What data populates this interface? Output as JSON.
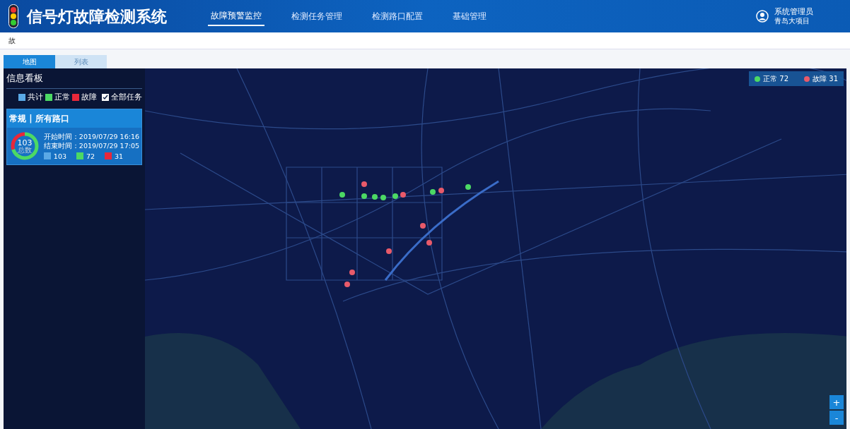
{
  "header": {
    "title": "信号灯故障检测系统",
    "nav": [
      {
        "label": "故障预警监控",
        "selected": true
      },
      {
        "label": "检测任务管理",
        "selected": false
      },
      {
        "label": "检测路口配置",
        "selected": false
      },
      {
        "label": "基础管理",
        "selected": false
      }
    ],
    "user": {
      "name": "系统管理员",
      "org": "青岛大项目"
    }
  },
  "breadcrumb": "故",
  "view_tabs": [
    {
      "label": "地图",
      "selected": true
    },
    {
      "label": "列表",
      "selected": false
    }
  ],
  "info_panel": {
    "title": "信息看板",
    "legend": [
      {
        "label": "共计",
        "color": "#5aa9e6"
      },
      {
        "label": "正常",
        "color": "#4cd964"
      },
      {
        "label": "故障",
        "color": "#e8283a"
      }
    ],
    "all_tasks": {
      "label": "全部任务",
      "checked": true
    },
    "card": {
      "title": "常规 | 所有路口",
      "total": "103",
      "total_label": "总数",
      "start": "开始时间：2019/07/29 16:16",
      "end": "结束时间：2019/07/29 17:05",
      "counts": [
        {
          "value": "103",
          "color": "#5aa9e6"
        },
        {
          "value": "72",
          "color": "#4cd964"
        },
        {
          "value": "31",
          "color": "#e8283a"
        }
      ]
    }
  },
  "map_legend": [
    {
      "label": "正常 72",
      "color": "#4cd964"
    },
    {
      "label": "故障 31",
      "color": "#e85a6a"
    }
  ],
  "markers": [
    {
      "color": "#4cd964"
    },
    {
      "color": "#4cd964"
    },
    {
      "color": "#4cd964"
    },
    {
      "color": "#4cd964"
    },
    {
      "color": "#4cd964"
    },
    {
      "color": "#4cd964"
    },
    {
      "color": "#4cd964"
    },
    {
      "color": "#e85a6a"
    },
    {
      "color": "#e85a6a"
    },
    {
      "color": "#e85a6a"
    },
    {
      "color": "#e85a6a"
    },
    {
      "color": "#e85a6a"
    },
    {
      "color": "#e85a6a"
    },
    {
      "color": "#e85a6a"
    },
    {
      "color": "#e85a6a"
    }
  ],
  "zoom": [
    "+",
    "-"
  ]
}
